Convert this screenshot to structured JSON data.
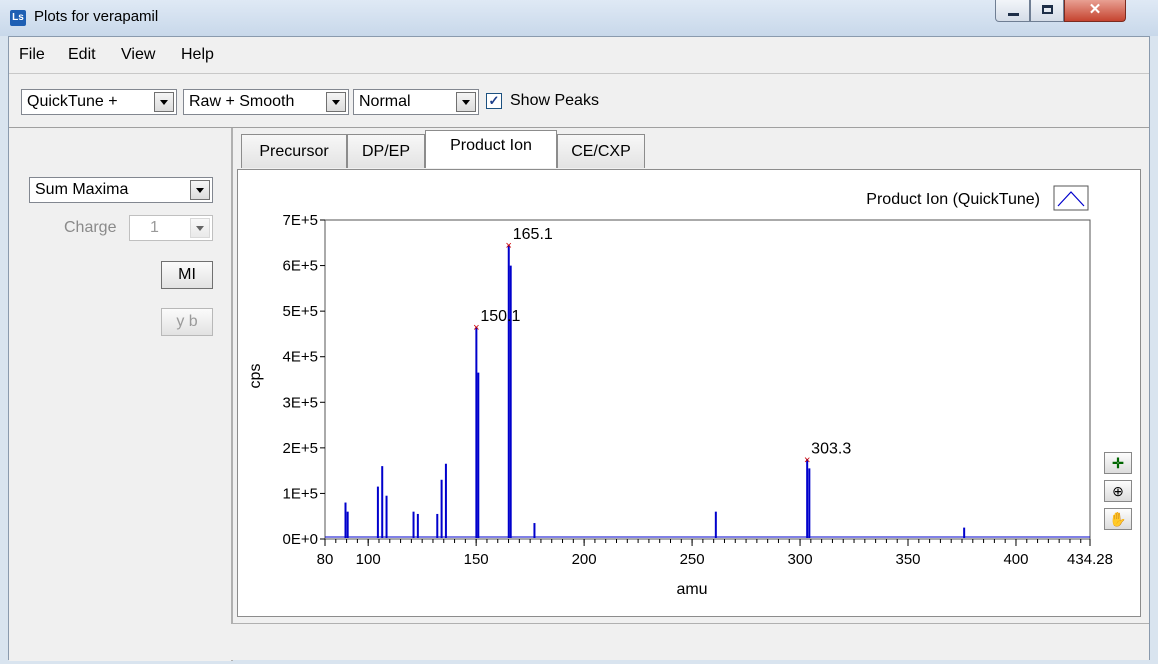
{
  "window": {
    "title": "Plots for verapamil",
    "icon": "Ls"
  },
  "menu": [
    "File",
    "Edit",
    "View",
    "Help"
  ],
  "toolbar": {
    "mode": "QuickTune +",
    "data_type": "Raw + Smooth",
    "scale": "Normal",
    "show_peaks_label": "Show Peaks",
    "show_peaks_checked": true
  },
  "left_panel": {
    "sum_select": "Sum Maxima",
    "charge_label": "Charge",
    "charge_value": "1",
    "mi_button": "MI",
    "yb_button": "y b"
  },
  "tabs": [
    {
      "label": "Precursor",
      "active": false
    },
    {
      "label": "DP/EP",
      "active": false
    },
    {
      "label": "Product Ion",
      "active": true
    },
    {
      "label": "CE/CXP",
      "active": false
    }
  ],
  "chart_data": {
    "type": "line",
    "legend": "Product Ion (QuickTune)",
    "xlabel": "amu",
    "ylabel": "cps",
    "xlim": [
      80,
      434.28
    ],
    "ylim": [
      0,
      700000
    ],
    "xticks": [
      "80",
      "100",
      "150",
      "200",
      "250",
      "300",
      "350",
      "400",
      "434.28"
    ],
    "yticks": [
      "0E+0",
      "1E+5",
      "2E+5",
      "3E+5",
      "4E+5",
      "5E+5",
      "6E+5",
      "7E+5"
    ],
    "line_color": "#0000cc",
    "peaks": [
      {
        "x": 89.5,
        "y": 80000
      },
      {
        "x": 90.5,
        "y": 60000
      },
      {
        "x": 104.5,
        "y": 115000
      },
      {
        "x": 106.5,
        "y": 160000
      },
      {
        "x": 108.5,
        "y": 95000
      },
      {
        "x": 121,
        "y": 60000
      },
      {
        "x": 123,
        "y": 55000
      },
      {
        "x": 132,
        "y": 55000
      },
      {
        "x": 134,
        "y": 130000
      },
      {
        "x": 136,
        "y": 165000
      },
      {
        "x": 150.1,
        "y": 465000
      },
      {
        "x": 151,
        "y": 365000
      },
      {
        "x": 165.1,
        "y": 645000
      },
      {
        "x": 166,
        "y": 600000
      },
      {
        "x": 177,
        "y": 35000
      },
      {
        "x": 261,
        "y": 60000
      },
      {
        "x": 303.3,
        "y": 175000
      },
      {
        "x": 304.3,
        "y": 155000
      },
      {
        "x": 376,
        "y": 25000
      }
    ],
    "labeled_peaks": [
      {
        "x": 150.1,
        "y": 465000,
        "label": "150.1"
      },
      {
        "x": 165.1,
        "y": 645000,
        "label": "165.1"
      },
      {
        "x": 303.3,
        "y": 175000,
        "label": "303.3"
      }
    ]
  }
}
